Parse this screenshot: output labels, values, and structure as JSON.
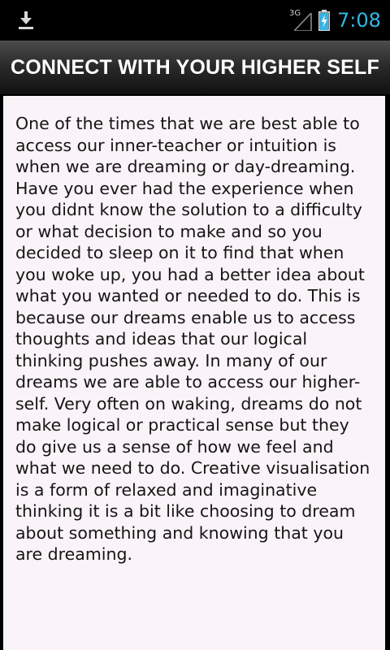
{
  "status_bar": {
    "icons": {
      "download": "download-icon",
      "signal": "signal-icon",
      "battery": "battery-charging-icon"
    },
    "network_type": "3G",
    "time": "7:08",
    "accent_color": "#33b5e5"
  },
  "header": {
    "title": "CONNECT WITH YOUR HIGHER SELF"
  },
  "content": {
    "body": "One of the times that we are best able to access our inner-teacher or intuition is when we are dreaming or day-dreaming. Have you ever had the experience when you didnt know the solution to a difficulty or what decision to make and so you decided to sleep on it to find that when you woke up, you had a better idea about what you wanted or needed to do. This is because our dreams enable us to access thoughts and ideas that our logical thinking pushes away. In many of our dreams we are able to access our higher-self. Very often on waking, dreams do not make logical or practical sense but they do give us a sense of how we feel and what we need to do. Creative visualisation is a form of relaxed and imaginative thinking it is a bit like choosing to dream about something and knowing that you are dreaming."
  }
}
